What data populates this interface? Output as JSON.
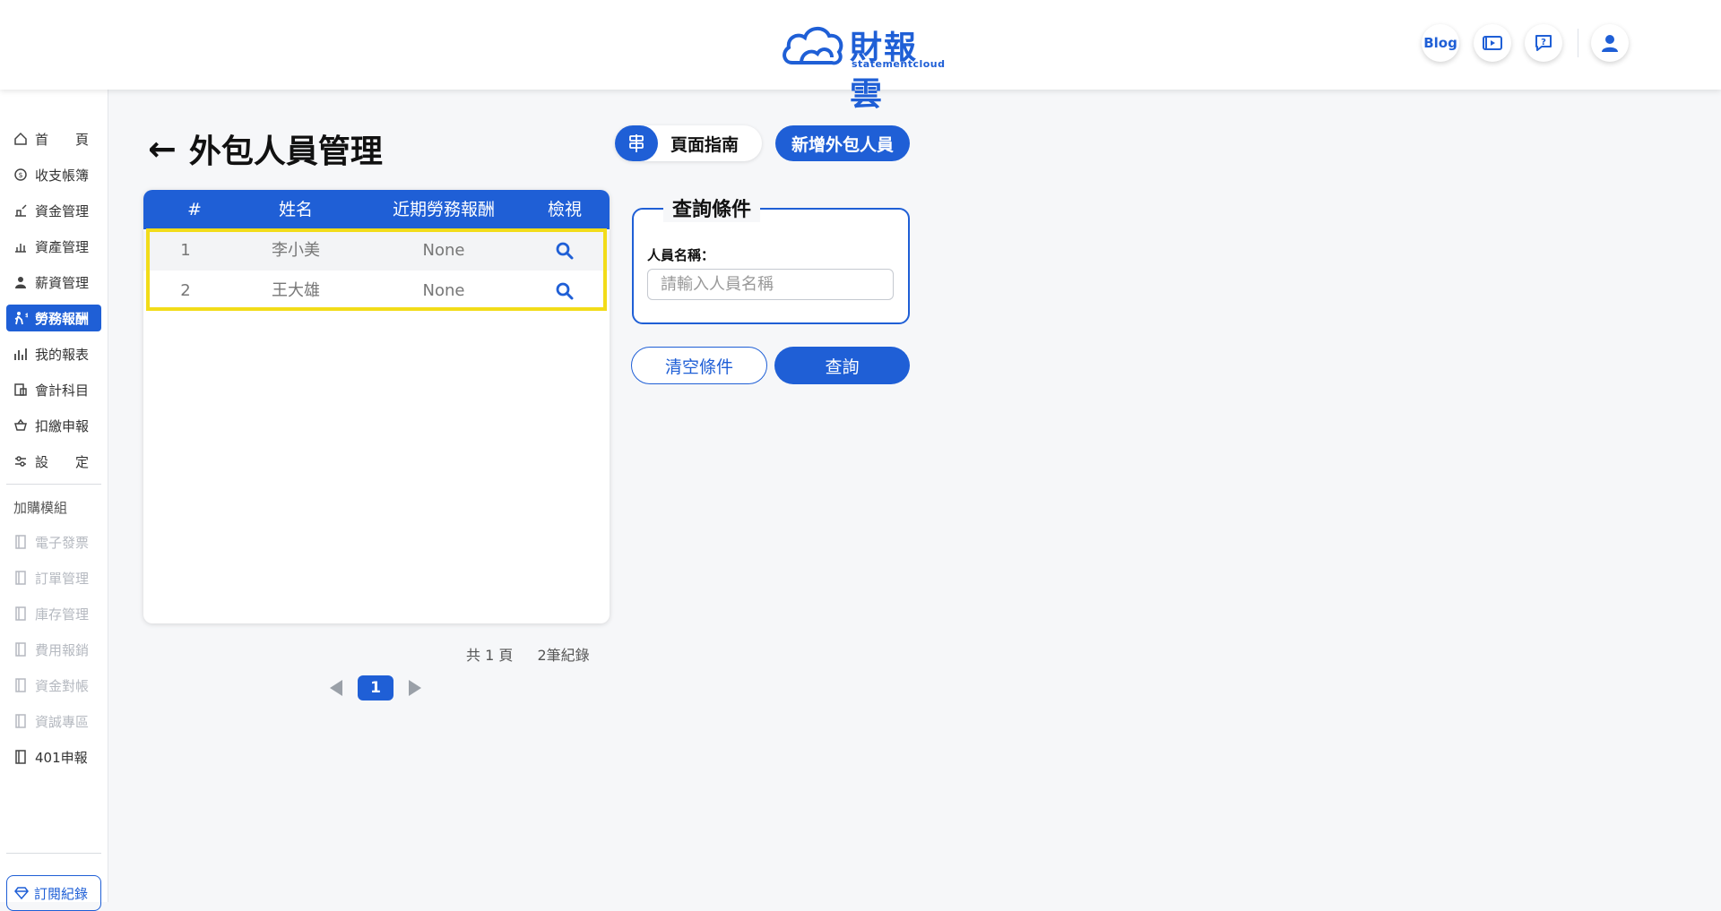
{
  "brand": {
    "name": "財報雲",
    "sub": "statementcloud"
  },
  "header": {
    "blog_label": "Blog"
  },
  "colors": {
    "primary": "#1f5fd6",
    "highlight": "#f2dc19"
  },
  "sidebar": {
    "items": [
      {
        "label": "首　　頁",
        "icon": "home-icon"
      },
      {
        "label": "收支帳簿",
        "icon": "ledger-icon"
      },
      {
        "label": "資金管理",
        "icon": "funds-icon"
      },
      {
        "label": "資產管理",
        "icon": "assets-icon"
      },
      {
        "label": "薪資管理",
        "icon": "salary-icon"
      },
      {
        "label": "勞務報酬",
        "icon": "labor-icon"
      },
      {
        "label": "我的報表",
        "icon": "report-icon"
      },
      {
        "label": "會計科目",
        "icon": "accounts-icon"
      },
      {
        "label": "扣繳申報",
        "icon": "withholding-icon"
      },
      {
        "label": "設　　定",
        "icon": "settings-icon"
      }
    ],
    "addon_heading": "加購模組",
    "addons": [
      {
        "label": "電子發票"
      },
      {
        "label": "訂單管理"
      },
      {
        "label": "庫存管理"
      },
      {
        "label": "費用報銷"
      },
      {
        "label": "資金對帳"
      },
      {
        "label": "資誠專區"
      },
      {
        "label": "401申報"
      }
    ],
    "subscription_label": "訂閱紀錄"
  },
  "page": {
    "title": "外包人員管理",
    "guide_label": "頁面指南",
    "add_label": "新增外包人員"
  },
  "table": {
    "headers": [
      "#",
      "姓名",
      "近期勞務報酬",
      "檢視"
    ],
    "rows": [
      {
        "index": "1",
        "name": "李小美",
        "recent": "None"
      },
      {
        "index": "2",
        "name": "王大雄",
        "recent": "None"
      }
    ]
  },
  "pagination": {
    "pages_text": "共 1 頁",
    "records_text": "2筆紀錄",
    "current": "1"
  },
  "query": {
    "legend": "查詢條件",
    "name_label": "人員名稱：",
    "name_placeholder": "請輸入人員名稱",
    "clear_label": "清空條件",
    "search_label": "查詢"
  }
}
